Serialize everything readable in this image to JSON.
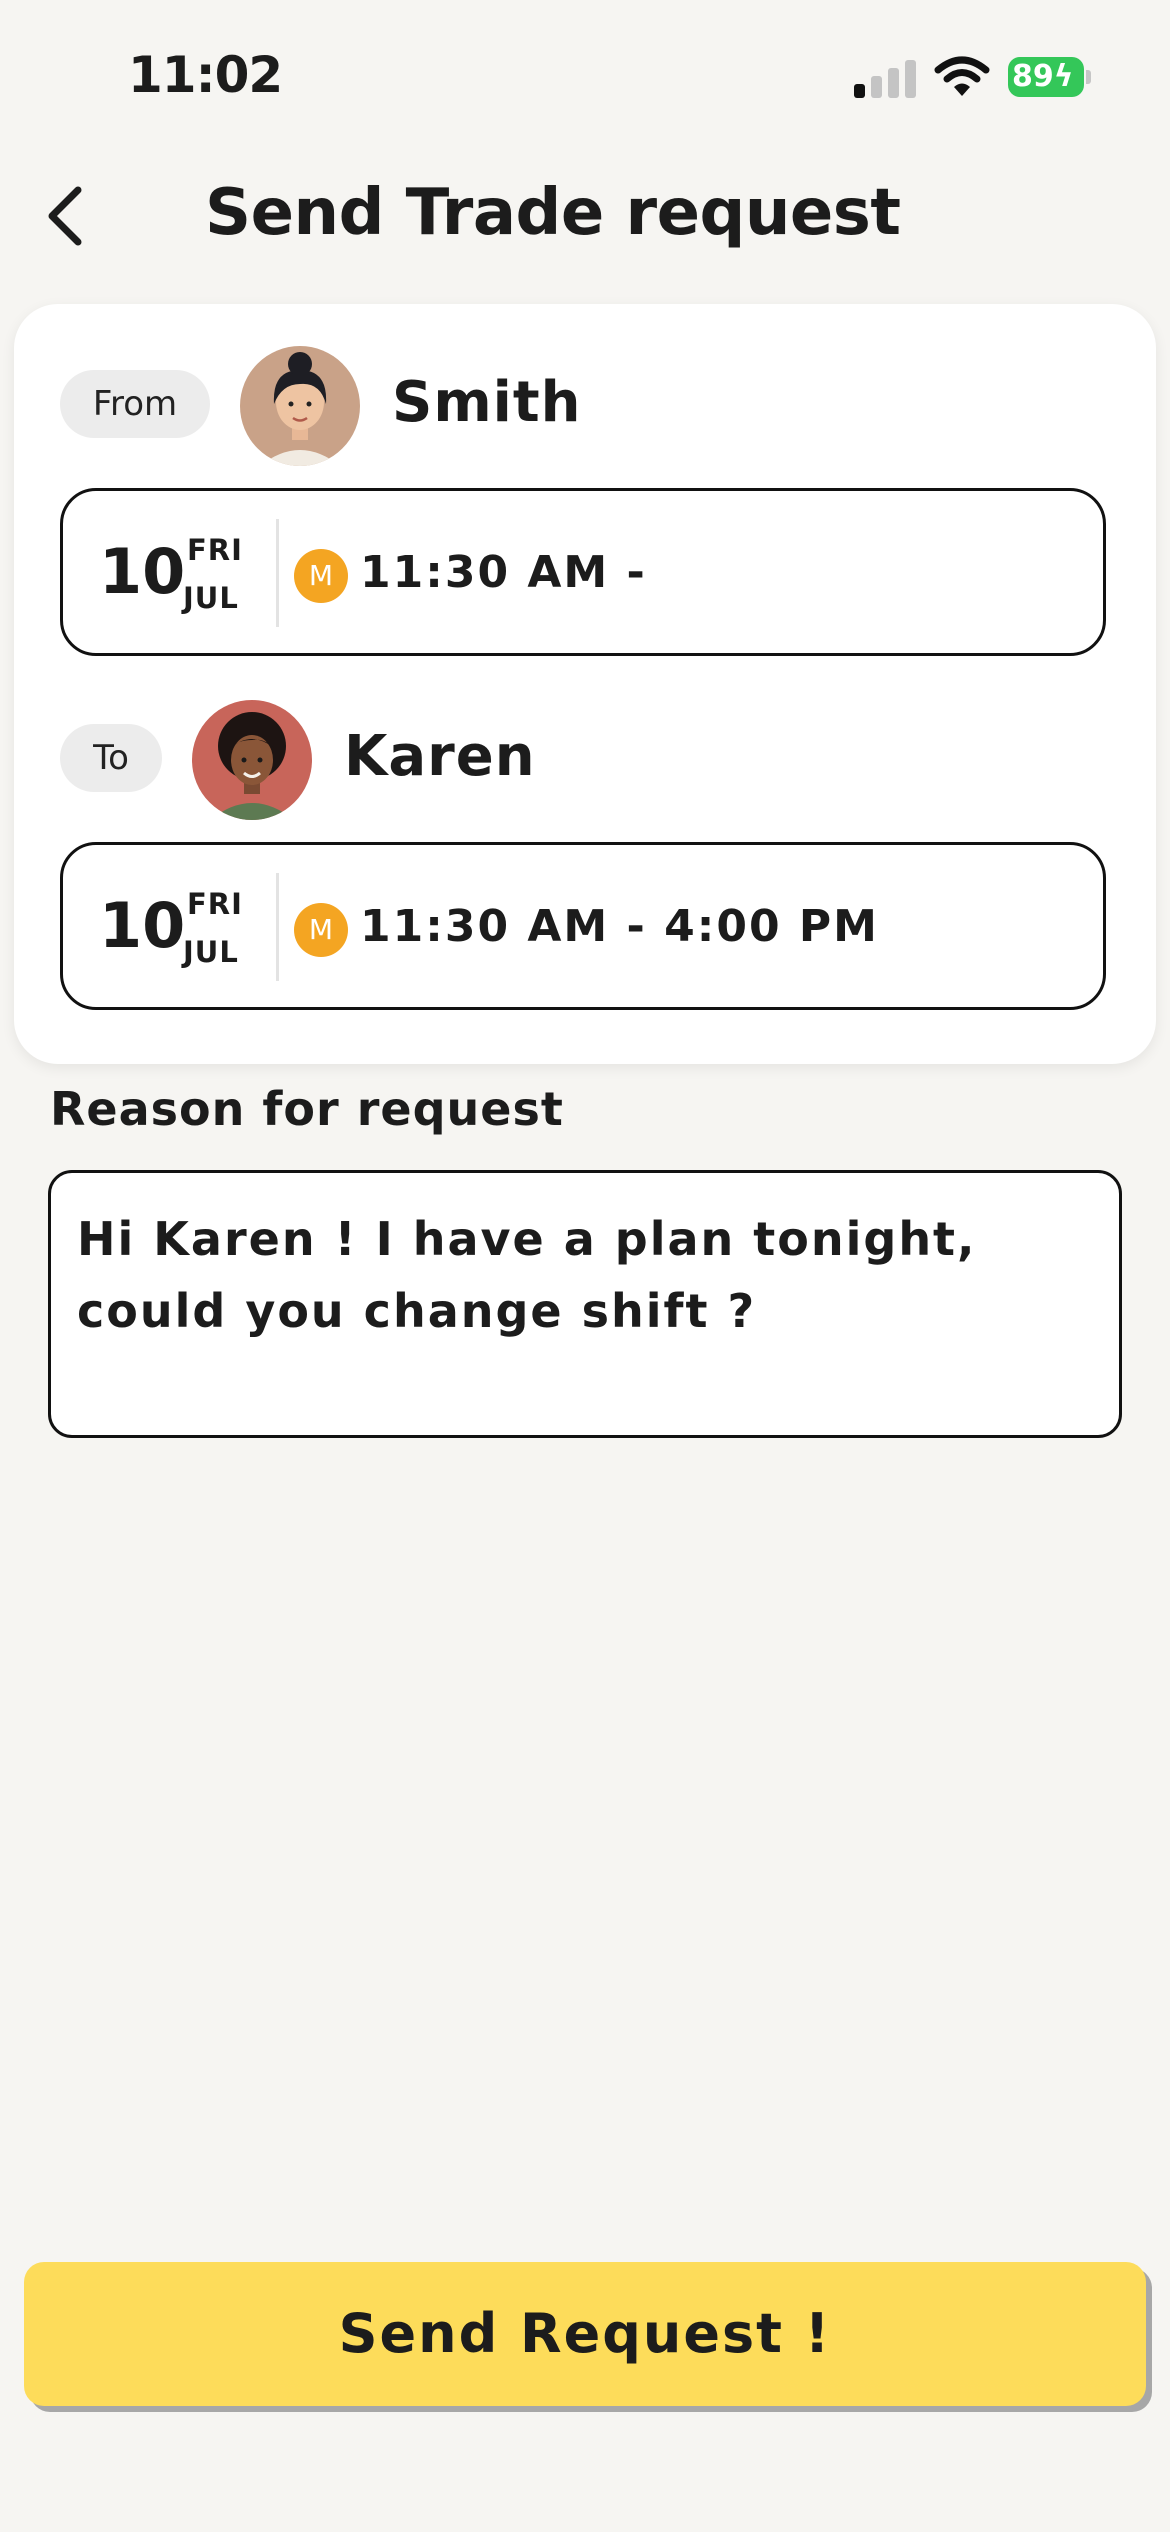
{
  "status_bar": {
    "time": "11:02",
    "battery": "89"
  },
  "header": {
    "title": "Send Trade request"
  },
  "from": {
    "label": "From",
    "name": "Smith",
    "shift": {
      "day": "10",
      "weekday": "FRI",
      "month": "JUL",
      "badge": "M",
      "time": "11:30 AM -"
    }
  },
  "to": {
    "label": "To",
    "name": "Karen",
    "shift": {
      "day": "10",
      "weekday": "FRI",
      "month": "JUL",
      "badge": "M",
      "time": "11:30 AM - 4:00 PM"
    }
  },
  "reason": {
    "label": "Reason for request",
    "value": "Hi Karen ! I have a plan tonight, could you change shift ?"
  },
  "send_button": {
    "label": "Send Request !"
  },
  "colors": {
    "accent": "#fddc5a",
    "badge": "#f4a522",
    "battery": "#34c759",
    "background": "#f6f5f2"
  },
  "icons": {
    "back": "chevron-left-icon",
    "signal": "cellular-signal-icon",
    "wifi": "wifi-icon",
    "battery": "battery-charging-icon"
  }
}
